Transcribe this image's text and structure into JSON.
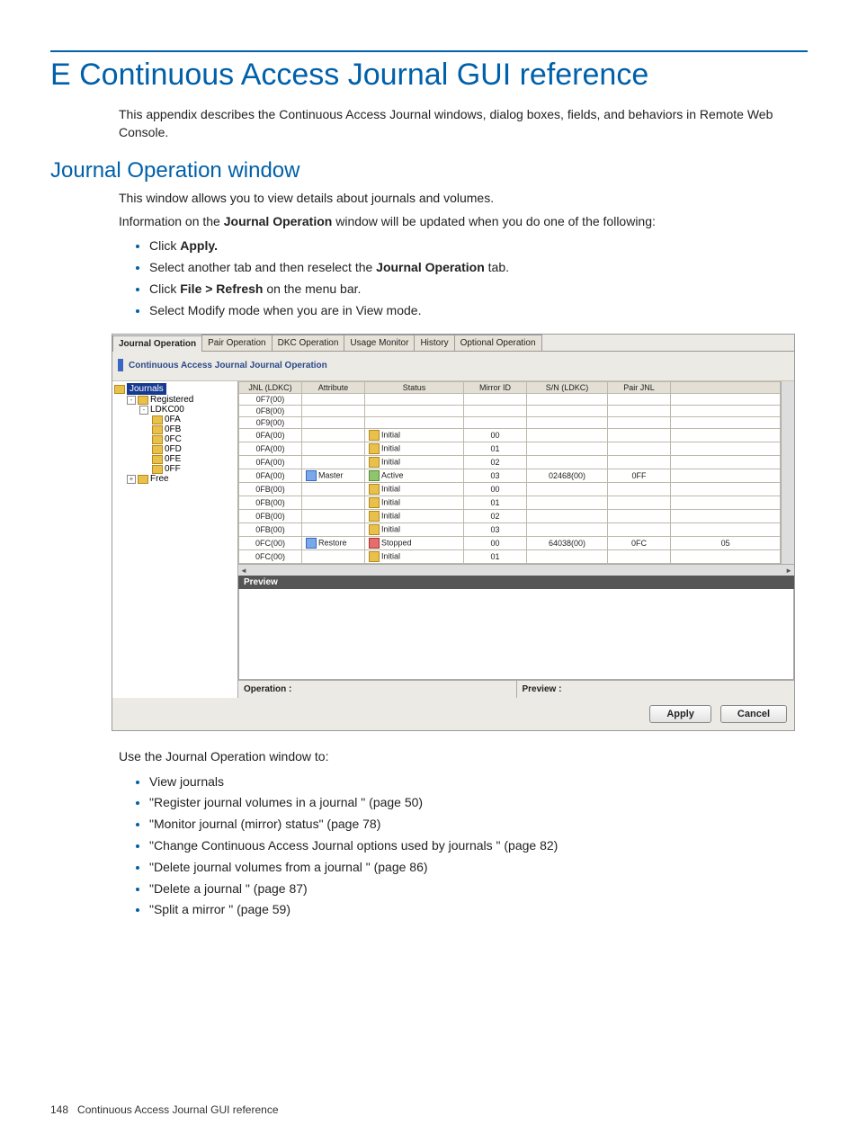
{
  "page": {
    "number": "148",
    "footer_title": "Continuous Access Journal GUI reference"
  },
  "heading": "E Continuous Access Journal GUI reference",
  "intro": "This appendix describes the Continuous Access Journal windows, dialog boxes, fields, and behaviors in Remote Web Console.",
  "section_heading": "Journal Operation window",
  "para1": "This window allows you to view details about journals and volumes.",
  "para2_pre": "Information on the ",
  "para2_b": "Journal Operation",
  "para2_post": " window will be updated when you do one of the following:",
  "list1": {
    "i0_pre": "Click ",
    "i0_b": "Apply.",
    "i1_pre": "Select another tab and then reselect the ",
    "i1_b": "Journal Operation",
    "i1_post": " tab.",
    "i2_pre": "Click ",
    "i2_b": "File > Refresh",
    "i2_post": " on the menu bar.",
    "i3": "Select Modify mode when you are in View mode."
  },
  "para3": "Use the Journal Operation window to:",
  "list2": {
    "i0": "View journals",
    "i1": "\"Register journal volumes in a journal \" (page 50)",
    "i2": "\"Monitor journal (mirror) status\" (page 78)",
    "i3": "\"Change Continuous Access Journal options used by journals \" (page 82)",
    "i4": "\"Delete journal volumes from a journal \" (page 86)",
    "i5": "\"Delete a journal \" (page 87)",
    "i6": "\"Split a mirror \" (page 59)"
  },
  "ss": {
    "tabs": [
      "Journal Operation",
      "Pair Operation",
      "DKC Operation",
      "Usage Monitor",
      "History",
      "Optional Operation"
    ],
    "panel_title": "Continuous Access Journal Journal Operation",
    "tree": {
      "root": "Journals",
      "reg": "Registered",
      "ldk": "LDKC00",
      "items": [
        "0FA",
        "0FB",
        "0FC",
        "0FD",
        "0FE",
        "0FF"
      ],
      "free": "Free"
    },
    "cols": [
      "JNL (LDKC)",
      "Attribute",
      "Status",
      "Mirror ID",
      "S/N (LDKC)",
      "Pair JNL"
    ],
    "rows": [
      {
        "jnl": "0F7(00)",
        "attr": "",
        "status": "",
        "mirror": "",
        "sn": "",
        "pair": "",
        "end": ""
      },
      {
        "jnl": "0F8(00)",
        "attr": "",
        "status": "",
        "mirror": "",
        "sn": "",
        "pair": "",
        "end": ""
      },
      {
        "jnl": "0F9(00)",
        "attr": "",
        "status": "",
        "mirror": "",
        "sn": "",
        "pair": "",
        "end": ""
      },
      {
        "jnl": "0FA(00)",
        "attr": "",
        "status": "Initial",
        "si": "y",
        "mirror": "00",
        "sn": "",
        "pair": "",
        "end": ""
      },
      {
        "jnl": "0FA(00)",
        "attr": "",
        "status": "Initial",
        "si": "y",
        "mirror": "01",
        "sn": "",
        "pair": "",
        "end": ""
      },
      {
        "jnl": "0FA(00)",
        "attr": "",
        "status": "Initial",
        "si": "y",
        "mirror": "02",
        "sn": "",
        "pair": "",
        "end": ""
      },
      {
        "jnl": "0FA(00)",
        "attr": "Master",
        "ai": "b",
        "status": "Active",
        "si": "g",
        "mirror": "03",
        "sn": "02468(00)",
        "pair": "0FF",
        "end": ""
      },
      {
        "jnl": "0FB(00)",
        "attr": "",
        "status": "Initial",
        "si": "y",
        "mirror": "00",
        "sn": "",
        "pair": "",
        "end": ""
      },
      {
        "jnl": "0FB(00)",
        "attr": "",
        "status": "Initial",
        "si": "y",
        "mirror": "01",
        "sn": "",
        "pair": "",
        "end": ""
      },
      {
        "jnl": "0FB(00)",
        "attr": "",
        "status": "Initial",
        "si": "y",
        "mirror": "02",
        "sn": "",
        "pair": "",
        "end": ""
      },
      {
        "jnl": "0FB(00)",
        "attr": "",
        "status": "Initial",
        "si": "y",
        "mirror": "03",
        "sn": "",
        "pair": "",
        "end": ""
      },
      {
        "jnl": "0FC(00)",
        "attr": "Restore",
        "ai": "b",
        "status": "Stopped",
        "si": "r",
        "mirror": "00",
        "sn": "64038(00)",
        "pair": "0FC",
        "end": "05"
      },
      {
        "jnl": "0FC(00)",
        "attr": "",
        "status": "Initial",
        "si": "y",
        "mirror": "01",
        "sn": "",
        "pair": "",
        "end": ""
      }
    ],
    "preview_label": "Preview",
    "op_label": "Operation :",
    "prev_label": "Preview :",
    "btn_apply": "Apply",
    "btn_cancel": "Cancel"
  }
}
